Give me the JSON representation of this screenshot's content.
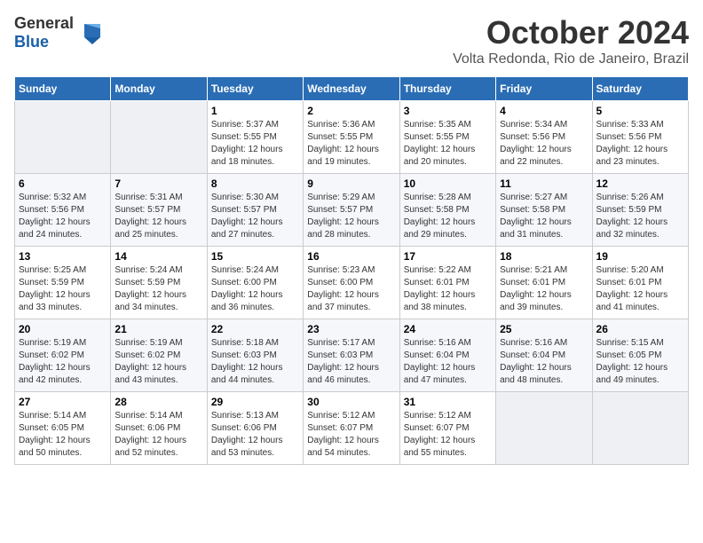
{
  "header": {
    "logo_general": "General",
    "logo_blue": "Blue",
    "month": "October 2024",
    "location": "Volta Redonda, Rio de Janeiro, Brazil"
  },
  "weekdays": [
    "Sunday",
    "Monday",
    "Tuesday",
    "Wednesday",
    "Thursday",
    "Friday",
    "Saturday"
  ],
  "weeks": [
    [
      {
        "day": "",
        "sunrise": "",
        "sunset": "",
        "daylight": ""
      },
      {
        "day": "",
        "sunrise": "",
        "sunset": "",
        "daylight": ""
      },
      {
        "day": "1",
        "sunrise": "Sunrise: 5:37 AM",
        "sunset": "Sunset: 5:55 PM",
        "daylight": "Daylight: 12 hours and 18 minutes."
      },
      {
        "day": "2",
        "sunrise": "Sunrise: 5:36 AM",
        "sunset": "Sunset: 5:55 PM",
        "daylight": "Daylight: 12 hours and 19 minutes."
      },
      {
        "day": "3",
        "sunrise": "Sunrise: 5:35 AM",
        "sunset": "Sunset: 5:55 PM",
        "daylight": "Daylight: 12 hours and 20 minutes."
      },
      {
        "day": "4",
        "sunrise": "Sunrise: 5:34 AM",
        "sunset": "Sunset: 5:56 PM",
        "daylight": "Daylight: 12 hours and 22 minutes."
      },
      {
        "day": "5",
        "sunrise": "Sunrise: 5:33 AM",
        "sunset": "Sunset: 5:56 PM",
        "daylight": "Daylight: 12 hours and 23 minutes."
      }
    ],
    [
      {
        "day": "6",
        "sunrise": "Sunrise: 5:32 AM",
        "sunset": "Sunset: 5:56 PM",
        "daylight": "Daylight: 12 hours and 24 minutes."
      },
      {
        "day": "7",
        "sunrise": "Sunrise: 5:31 AM",
        "sunset": "Sunset: 5:57 PM",
        "daylight": "Daylight: 12 hours and 25 minutes."
      },
      {
        "day": "8",
        "sunrise": "Sunrise: 5:30 AM",
        "sunset": "Sunset: 5:57 PM",
        "daylight": "Daylight: 12 hours and 27 minutes."
      },
      {
        "day": "9",
        "sunrise": "Sunrise: 5:29 AM",
        "sunset": "Sunset: 5:57 PM",
        "daylight": "Daylight: 12 hours and 28 minutes."
      },
      {
        "day": "10",
        "sunrise": "Sunrise: 5:28 AM",
        "sunset": "Sunset: 5:58 PM",
        "daylight": "Daylight: 12 hours and 29 minutes."
      },
      {
        "day": "11",
        "sunrise": "Sunrise: 5:27 AM",
        "sunset": "Sunset: 5:58 PM",
        "daylight": "Daylight: 12 hours and 31 minutes."
      },
      {
        "day": "12",
        "sunrise": "Sunrise: 5:26 AM",
        "sunset": "Sunset: 5:59 PM",
        "daylight": "Daylight: 12 hours and 32 minutes."
      }
    ],
    [
      {
        "day": "13",
        "sunrise": "Sunrise: 5:25 AM",
        "sunset": "Sunset: 5:59 PM",
        "daylight": "Daylight: 12 hours and 33 minutes."
      },
      {
        "day": "14",
        "sunrise": "Sunrise: 5:24 AM",
        "sunset": "Sunset: 5:59 PM",
        "daylight": "Daylight: 12 hours and 34 minutes."
      },
      {
        "day": "15",
        "sunrise": "Sunrise: 5:24 AM",
        "sunset": "Sunset: 6:00 PM",
        "daylight": "Daylight: 12 hours and 36 minutes."
      },
      {
        "day": "16",
        "sunrise": "Sunrise: 5:23 AM",
        "sunset": "Sunset: 6:00 PM",
        "daylight": "Daylight: 12 hours and 37 minutes."
      },
      {
        "day": "17",
        "sunrise": "Sunrise: 5:22 AM",
        "sunset": "Sunset: 6:01 PM",
        "daylight": "Daylight: 12 hours and 38 minutes."
      },
      {
        "day": "18",
        "sunrise": "Sunrise: 5:21 AM",
        "sunset": "Sunset: 6:01 PM",
        "daylight": "Daylight: 12 hours and 39 minutes."
      },
      {
        "day": "19",
        "sunrise": "Sunrise: 5:20 AM",
        "sunset": "Sunset: 6:01 PM",
        "daylight": "Daylight: 12 hours and 41 minutes."
      }
    ],
    [
      {
        "day": "20",
        "sunrise": "Sunrise: 5:19 AM",
        "sunset": "Sunset: 6:02 PM",
        "daylight": "Daylight: 12 hours and 42 minutes."
      },
      {
        "day": "21",
        "sunrise": "Sunrise: 5:19 AM",
        "sunset": "Sunset: 6:02 PM",
        "daylight": "Daylight: 12 hours and 43 minutes."
      },
      {
        "day": "22",
        "sunrise": "Sunrise: 5:18 AM",
        "sunset": "Sunset: 6:03 PM",
        "daylight": "Daylight: 12 hours and 44 minutes."
      },
      {
        "day": "23",
        "sunrise": "Sunrise: 5:17 AM",
        "sunset": "Sunset: 6:03 PM",
        "daylight": "Daylight: 12 hours and 46 minutes."
      },
      {
        "day": "24",
        "sunrise": "Sunrise: 5:16 AM",
        "sunset": "Sunset: 6:04 PM",
        "daylight": "Daylight: 12 hours and 47 minutes."
      },
      {
        "day": "25",
        "sunrise": "Sunrise: 5:16 AM",
        "sunset": "Sunset: 6:04 PM",
        "daylight": "Daylight: 12 hours and 48 minutes."
      },
      {
        "day": "26",
        "sunrise": "Sunrise: 5:15 AM",
        "sunset": "Sunset: 6:05 PM",
        "daylight": "Daylight: 12 hours and 49 minutes."
      }
    ],
    [
      {
        "day": "27",
        "sunrise": "Sunrise: 5:14 AM",
        "sunset": "Sunset: 6:05 PM",
        "daylight": "Daylight: 12 hours and 50 minutes."
      },
      {
        "day": "28",
        "sunrise": "Sunrise: 5:14 AM",
        "sunset": "Sunset: 6:06 PM",
        "daylight": "Daylight: 12 hours and 52 minutes."
      },
      {
        "day": "29",
        "sunrise": "Sunrise: 5:13 AM",
        "sunset": "Sunset: 6:06 PM",
        "daylight": "Daylight: 12 hours and 53 minutes."
      },
      {
        "day": "30",
        "sunrise": "Sunrise: 5:12 AM",
        "sunset": "Sunset: 6:07 PM",
        "daylight": "Daylight: 12 hours and 54 minutes."
      },
      {
        "day": "31",
        "sunrise": "Sunrise: 5:12 AM",
        "sunset": "Sunset: 6:07 PM",
        "daylight": "Daylight: 12 hours and 55 minutes."
      },
      {
        "day": "",
        "sunrise": "",
        "sunset": "",
        "daylight": ""
      },
      {
        "day": "",
        "sunrise": "",
        "sunset": "",
        "daylight": ""
      }
    ]
  ]
}
